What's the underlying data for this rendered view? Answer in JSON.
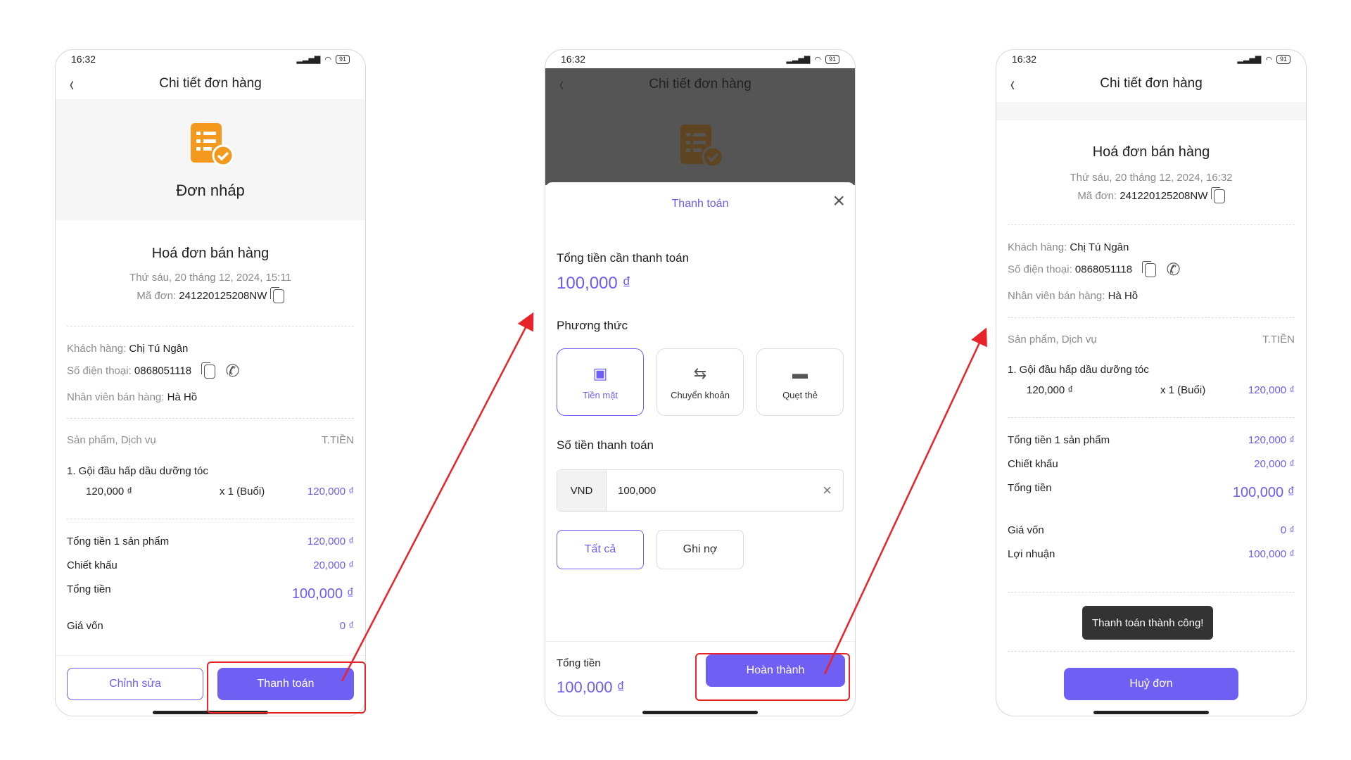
{
  "status_time": "16:32",
  "battery": "91",
  "screen1": {
    "title": "Chi tiết đơn hàng",
    "status_label": "Đơn nháp",
    "invoice_title": "Hoá đơn bán hàng",
    "datetime": "Thứ sáu, 20 tháng 12, 2024, 15:11",
    "order_code_label": "Mã đơn:",
    "order_code": "241220125208NW",
    "customer_label": "Khách hàng:",
    "customer": "Chị Tú Ngân",
    "phone_label": "Số điện thoại:",
    "phone": "0868051118",
    "staff_label": "Nhân viên bán hàng:",
    "staff": "Hà Hồ",
    "col_product": "Sản phẩm, Dịch vụ",
    "col_total": "T.TIỀN",
    "item_name": "1.   Gội đầu hấp dầu dưỡng tóc",
    "item_price": "120,000 ₫",
    "item_qty": "x 1 (Buổi)",
    "item_total": "120,000 ₫",
    "subtotal_label": "Tổng tiền 1 sản phẩm",
    "subtotal": "120,000 ₫",
    "discount_label": "Chiết khấu",
    "discount": "20,000 ₫",
    "total_label": "Tổng tiền",
    "total": "100,000 ₫",
    "cost_label": "Giá vốn",
    "cost": "0 ₫",
    "edit_button": "Chỉnh sửa",
    "pay_button": "Thanh toán"
  },
  "screen2": {
    "title": "Chi tiết đơn hàng",
    "modal_title": "Thanh toán",
    "amount_due_label": "Tổng tiền cần thanh toán",
    "amount_due": "100,000 ₫",
    "method_label": "Phương thức",
    "methods": [
      "Tiền mặt",
      "Chuyển khoản",
      "Quẹt thẻ"
    ],
    "pay_amount_label": "Số tiền thanh toán",
    "currency": "VND",
    "amount_value": "100,000",
    "all_button": "Tất cả",
    "debt_button": "Ghi nợ",
    "footer_total_label": "Tổng tiền",
    "footer_total": "100,000 ₫",
    "complete_button": "Hoàn thành"
  },
  "screen3": {
    "title": "Chi tiết đơn hàng",
    "invoice_title": "Hoá đơn bán hàng",
    "datetime": "Thứ sáu, 20 tháng 12, 2024, 16:32",
    "order_code_label": "Mã đơn:",
    "order_code": "241220125208NW",
    "customer_label": "Khách hàng:",
    "customer": "Chị Tú Ngân",
    "phone_label": "Số điện thoại:",
    "phone": "0868051118",
    "staff_label": "Nhân viên bán hàng:",
    "staff": "Hà Hồ",
    "col_product": "Sản phẩm, Dịch vụ",
    "col_total": "T.TIỀN",
    "item_name": "1.   Gội đầu hấp dầu dưỡng tóc",
    "item_price": "120,000 ₫",
    "item_qty": "x 1 (Buổi)",
    "item_total": "120,000 ₫",
    "subtotal_label": "Tổng tiền 1 sản phẩm",
    "subtotal": "120,000 ₫",
    "discount_label": "Chiết khấu",
    "discount": "20,000 ₫",
    "total_label": "Tổng tiền",
    "total": "100,000 ₫",
    "cost_label": "Giá vốn",
    "cost": "0 ₫",
    "profit_label": "Lợi nhuận",
    "profit": "100,000 ₫",
    "toast": "Thanh toán thành công!",
    "cancel_button": "Huỷ đơn"
  },
  "colors": {
    "accent": "#6f5ff3",
    "highlight": "#e8232a",
    "draft_icon": "#f39a1e"
  }
}
